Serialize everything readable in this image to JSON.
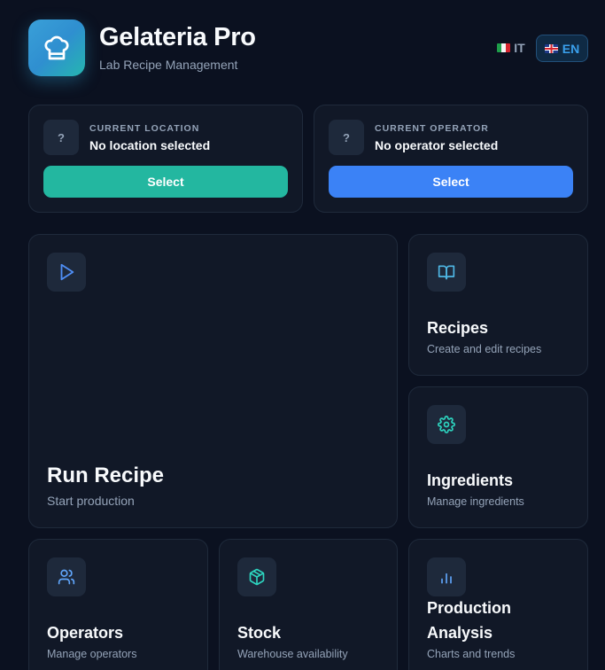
{
  "app": {
    "title": "Gelateria Pro",
    "subtitle": "Lab Recipe Management",
    "icon": "chef-hat-icon",
    "accent": "#3aa0d8"
  },
  "languages": [
    {
      "code": "IT",
      "flag": "italy-flag",
      "active": false
    },
    {
      "code": "EN",
      "flag": "uk-flag",
      "active": true
    }
  ],
  "location": {
    "caption": "CURRENT LOCATION",
    "value": "No location selected",
    "placeholder_icon": "?",
    "button": "Select",
    "button_color": "#23b7a0"
  },
  "operator": {
    "caption": "CURRENT OPERATOR",
    "value": "No operator selected",
    "placeholder_icon": "?",
    "button": "Select",
    "button_color": "#3b82f6"
  },
  "cards": {
    "run_recipe": {
      "title": "Run Recipe",
      "subtitle": "Start production",
      "icon": "play-icon"
    },
    "recipes": {
      "title": "Recipes",
      "subtitle": "Create and edit recipes",
      "icon": "book-icon"
    },
    "ingredients": {
      "title": "Ingredients",
      "subtitle": "Manage ingredients",
      "icon": "gear-icon"
    },
    "operators": {
      "title": "Operators",
      "subtitle": "Manage operators",
      "icon": "users-icon"
    },
    "stock": {
      "title": "Stock",
      "subtitle": "Warehouse availability",
      "icon": "box-icon"
    },
    "analysis": {
      "title_line1": "Production",
      "title_line2": "Analysis",
      "subtitle": "Charts and trends",
      "icon": "bar-chart-icon"
    }
  }
}
